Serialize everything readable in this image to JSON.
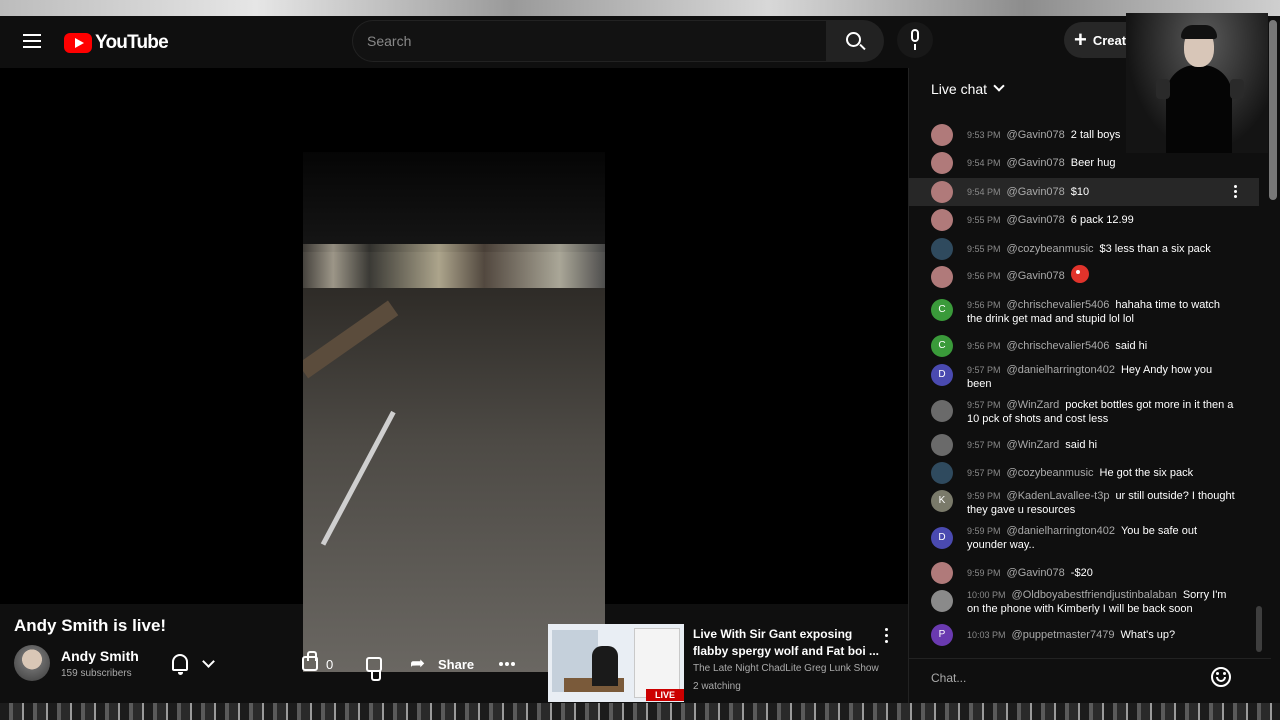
{
  "header": {
    "logo_text": "YouTube",
    "search_placeholder": "Search",
    "create_label": "Creat"
  },
  "video": {
    "title": "Andy Smith is live!",
    "channel": "Andy Smith",
    "subscribers": "159 subscribers",
    "likes": "0",
    "share_label": "Share"
  },
  "recommended": {
    "title": "Live With Sir Gant exposing flabby spergy wolf and Fat boi ...",
    "channel": "The Late Night ChadLite Greg Lunk Show",
    "watching": "2 watching",
    "badge": "LIVE"
  },
  "chat": {
    "title": "Live chat",
    "input_placeholder": "Chat...",
    "messages": [
      {
        "time": "9:53 PM",
        "user": "@Gavin078",
        "text": "2 tall boys",
        "avatar": "",
        "avatar_color": "#b07a7a"
      },
      {
        "time": "9:54 PM",
        "user": "@Gavin078",
        "text": "Beer hug",
        "avatar": "",
        "avatar_color": "#b07a7a"
      },
      {
        "time": "9:54 PM",
        "user": "@Gavin078",
        "text": "$10",
        "avatar": "",
        "avatar_color": "#b07a7a"
      },
      {
        "time": "9:55 PM",
        "user": "@Gavin078",
        "text": "6 pack 12.99",
        "avatar": "",
        "avatar_color": "#b07a7a"
      },
      {
        "time": "9:55 PM",
        "user": "@cozybeanmusic",
        "text": "$3 less than a six pack",
        "avatar": "",
        "avatar_color": "#2f4a5e"
      },
      {
        "time": "9:56 PM",
        "user": "@Gavin078",
        "text": "",
        "avatar": "",
        "avatar_color": "#b07a7a"
      },
      {
        "time": "9:56 PM",
        "user": "@chrischevalier5406",
        "text": "hahaha time to watch the drink get mad and stupid lol lol",
        "avatar": "C",
        "avatar_color": "#3a9a3a"
      },
      {
        "time": "9:56 PM",
        "user": "@chrischevalier5406",
        "text": "said hi",
        "avatar": "C",
        "avatar_color": "#3a9a3a"
      },
      {
        "time": "9:57 PM",
        "user": "@danielharrington402",
        "text": "Hey Andy how you been",
        "avatar": "D",
        "avatar_color": "#4a4ab0"
      },
      {
        "time": "9:57 PM",
        "user": "@WinZard",
        "text": "pocket bottles got more in it then a 10 pck of shots and cost less",
        "avatar": "",
        "avatar_color": "#6a6a6a"
      },
      {
        "time": "9:57 PM",
        "user": "@WinZard",
        "text": "said hi",
        "avatar": "",
        "avatar_color": "#6a6a6a"
      },
      {
        "time": "9:57 PM",
        "user": "@cozybeanmusic",
        "text": "He got the six pack",
        "avatar": "",
        "avatar_color": "#2f4a5e"
      },
      {
        "time": "9:59 PM",
        "user": "@KadenLavallee-t3p",
        "text": "ur still outside? I thought they gave u resources",
        "avatar": "K",
        "avatar_color": "#7a7a6a"
      },
      {
        "time": "9:59 PM",
        "user": "@danielharrington402",
        "text": "You be safe out younder way..",
        "avatar": "D",
        "avatar_color": "#4a4ab0"
      },
      {
        "time": "9:59 PM",
        "user": "@Gavin078",
        "text": "-$20",
        "avatar": "",
        "avatar_color": "#b07a7a"
      },
      {
        "time": "10:00 PM",
        "user": "@Oldboyabestfriendjustinbalaban",
        "text": "Sorry I'm on the phone with Kimberly I will be back soon",
        "avatar": "",
        "avatar_color": "#8a8a8a"
      },
      {
        "time": "10:03 PM",
        "user": "@puppetmaster7479",
        "text": "What's up?",
        "avatar": "P",
        "avatar_color": "#6a3ab0"
      }
    ]
  }
}
